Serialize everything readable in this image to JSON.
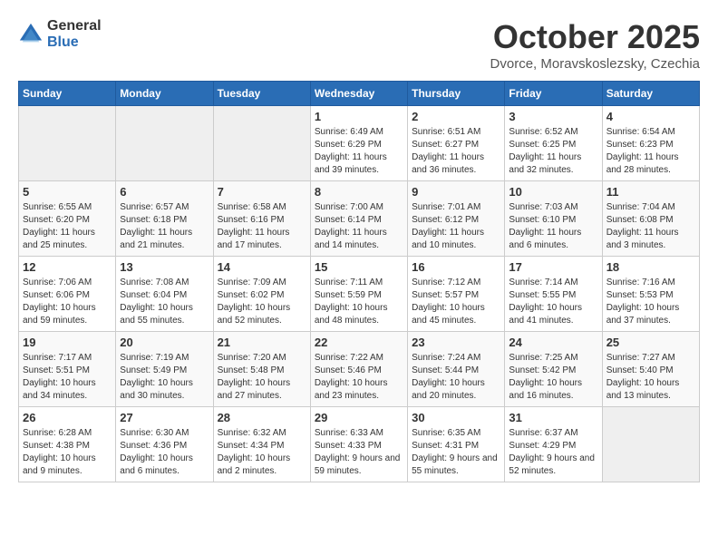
{
  "header": {
    "logo_general": "General",
    "logo_blue": "Blue",
    "month_title": "October 2025",
    "location": "Dvorce, Moravskoslezsky, Czechia"
  },
  "weekdays": [
    "Sunday",
    "Monday",
    "Tuesday",
    "Wednesday",
    "Thursday",
    "Friday",
    "Saturday"
  ],
  "weeks": [
    [
      {
        "day": "",
        "empty": true
      },
      {
        "day": "",
        "empty": true
      },
      {
        "day": "",
        "empty": true
      },
      {
        "day": "1",
        "sunrise": "Sunrise: 6:49 AM",
        "sunset": "Sunset: 6:29 PM",
        "daylight": "Daylight: 11 hours and 39 minutes."
      },
      {
        "day": "2",
        "sunrise": "Sunrise: 6:51 AM",
        "sunset": "Sunset: 6:27 PM",
        "daylight": "Daylight: 11 hours and 36 minutes."
      },
      {
        "day": "3",
        "sunrise": "Sunrise: 6:52 AM",
        "sunset": "Sunset: 6:25 PM",
        "daylight": "Daylight: 11 hours and 32 minutes."
      },
      {
        "day": "4",
        "sunrise": "Sunrise: 6:54 AM",
        "sunset": "Sunset: 6:23 PM",
        "daylight": "Daylight: 11 hours and 28 minutes."
      }
    ],
    [
      {
        "day": "5",
        "sunrise": "Sunrise: 6:55 AM",
        "sunset": "Sunset: 6:20 PM",
        "daylight": "Daylight: 11 hours and 25 minutes."
      },
      {
        "day": "6",
        "sunrise": "Sunrise: 6:57 AM",
        "sunset": "Sunset: 6:18 PM",
        "daylight": "Daylight: 11 hours and 21 minutes."
      },
      {
        "day": "7",
        "sunrise": "Sunrise: 6:58 AM",
        "sunset": "Sunset: 6:16 PM",
        "daylight": "Daylight: 11 hours and 17 minutes."
      },
      {
        "day": "8",
        "sunrise": "Sunrise: 7:00 AM",
        "sunset": "Sunset: 6:14 PM",
        "daylight": "Daylight: 11 hours and 14 minutes."
      },
      {
        "day": "9",
        "sunrise": "Sunrise: 7:01 AM",
        "sunset": "Sunset: 6:12 PM",
        "daylight": "Daylight: 11 hours and 10 minutes."
      },
      {
        "day": "10",
        "sunrise": "Sunrise: 7:03 AM",
        "sunset": "Sunset: 6:10 PM",
        "daylight": "Daylight: 11 hours and 6 minutes."
      },
      {
        "day": "11",
        "sunrise": "Sunrise: 7:04 AM",
        "sunset": "Sunset: 6:08 PM",
        "daylight": "Daylight: 11 hours and 3 minutes."
      }
    ],
    [
      {
        "day": "12",
        "sunrise": "Sunrise: 7:06 AM",
        "sunset": "Sunset: 6:06 PM",
        "daylight": "Daylight: 10 hours and 59 minutes."
      },
      {
        "day": "13",
        "sunrise": "Sunrise: 7:08 AM",
        "sunset": "Sunset: 6:04 PM",
        "daylight": "Daylight: 10 hours and 55 minutes."
      },
      {
        "day": "14",
        "sunrise": "Sunrise: 7:09 AM",
        "sunset": "Sunset: 6:02 PM",
        "daylight": "Daylight: 10 hours and 52 minutes."
      },
      {
        "day": "15",
        "sunrise": "Sunrise: 7:11 AM",
        "sunset": "Sunset: 5:59 PM",
        "daylight": "Daylight: 10 hours and 48 minutes."
      },
      {
        "day": "16",
        "sunrise": "Sunrise: 7:12 AM",
        "sunset": "Sunset: 5:57 PM",
        "daylight": "Daylight: 10 hours and 45 minutes."
      },
      {
        "day": "17",
        "sunrise": "Sunrise: 7:14 AM",
        "sunset": "Sunset: 5:55 PM",
        "daylight": "Daylight: 10 hours and 41 minutes."
      },
      {
        "day": "18",
        "sunrise": "Sunrise: 7:16 AM",
        "sunset": "Sunset: 5:53 PM",
        "daylight": "Daylight: 10 hours and 37 minutes."
      }
    ],
    [
      {
        "day": "19",
        "sunrise": "Sunrise: 7:17 AM",
        "sunset": "Sunset: 5:51 PM",
        "daylight": "Daylight: 10 hours and 34 minutes."
      },
      {
        "day": "20",
        "sunrise": "Sunrise: 7:19 AM",
        "sunset": "Sunset: 5:49 PM",
        "daylight": "Daylight: 10 hours and 30 minutes."
      },
      {
        "day": "21",
        "sunrise": "Sunrise: 7:20 AM",
        "sunset": "Sunset: 5:48 PM",
        "daylight": "Daylight: 10 hours and 27 minutes."
      },
      {
        "day": "22",
        "sunrise": "Sunrise: 7:22 AM",
        "sunset": "Sunset: 5:46 PM",
        "daylight": "Daylight: 10 hours and 23 minutes."
      },
      {
        "day": "23",
        "sunrise": "Sunrise: 7:24 AM",
        "sunset": "Sunset: 5:44 PM",
        "daylight": "Daylight: 10 hours and 20 minutes."
      },
      {
        "day": "24",
        "sunrise": "Sunrise: 7:25 AM",
        "sunset": "Sunset: 5:42 PM",
        "daylight": "Daylight: 10 hours and 16 minutes."
      },
      {
        "day": "25",
        "sunrise": "Sunrise: 7:27 AM",
        "sunset": "Sunset: 5:40 PM",
        "daylight": "Daylight: 10 hours and 13 minutes."
      }
    ],
    [
      {
        "day": "26",
        "sunrise": "Sunrise: 6:28 AM",
        "sunset": "Sunset: 4:38 PM",
        "daylight": "Daylight: 10 hours and 9 minutes."
      },
      {
        "day": "27",
        "sunrise": "Sunrise: 6:30 AM",
        "sunset": "Sunset: 4:36 PM",
        "daylight": "Daylight: 10 hours and 6 minutes."
      },
      {
        "day": "28",
        "sunrise": "Sunrise: 6:32 AM",
        "sunset": "Sunset: 4:34 PM",
        "daylight": "Daylight: 10 hours and 2 minutes."
      },
      {
        "day": "29",
        "sunrise": "Sunrise: 6:33 AM",
        "sunset": "Sunset: 4:33 PM",
        "daylight": "Daylight: 9 hours and 59 minutes."
      },
      {
        "day": "30",
        "sunrise": "Sunrise: 6:35 AM",
        "sunset": "Sunset: 4:31 PM",
        "daylight": "Daylight: 9 hours and 55 minutes."
      },
      {
        "day": "31",
        "sunrise": "Sunrise: 6:37 AM",
        "sunset": "Sunset: 4:29 PM",
        "daylight": "Daylight: 9 hours and 52 minutes."
      },
      {
        "day": "",
        "empty": true
      }
    ]
  ]
}
